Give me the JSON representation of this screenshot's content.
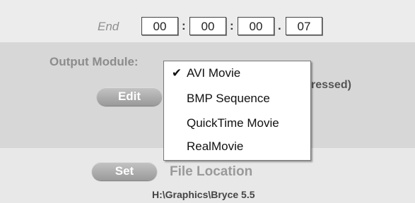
{
  "end_timecode": {
    "label": "End",
    "hours": "00",
    "minutes": "00",
    "seconds": "00",
    "frames": "07",
    "sep_colon": ":",
    "sep_dot": "."
  },
  "output_module": {
    "label": "Output Module:",
    "compression_tail": "ressed)",
    "edit_button": "Edit"
  },
  "dropdown": {
    "items": [
      {
        "label": "AVI Movie",
        "checked": true,
        "check": "✔"
      },
      {
        "label": "BMP Sequence",
        "checked": false,
        "check": ""
      },
      {
        "label": "QuickTime Movie",
        "checked": false,
        "check": ""
      },
      {
        "label": "RealMovie",
        "checked": false,
        "check": ""
      }
    ]
  },
  "file_location": {
    "set_button": "Set",
    "label": "File Location",
    "path": "H:\\Graphics\\Bryce 5.5"
  }
}
